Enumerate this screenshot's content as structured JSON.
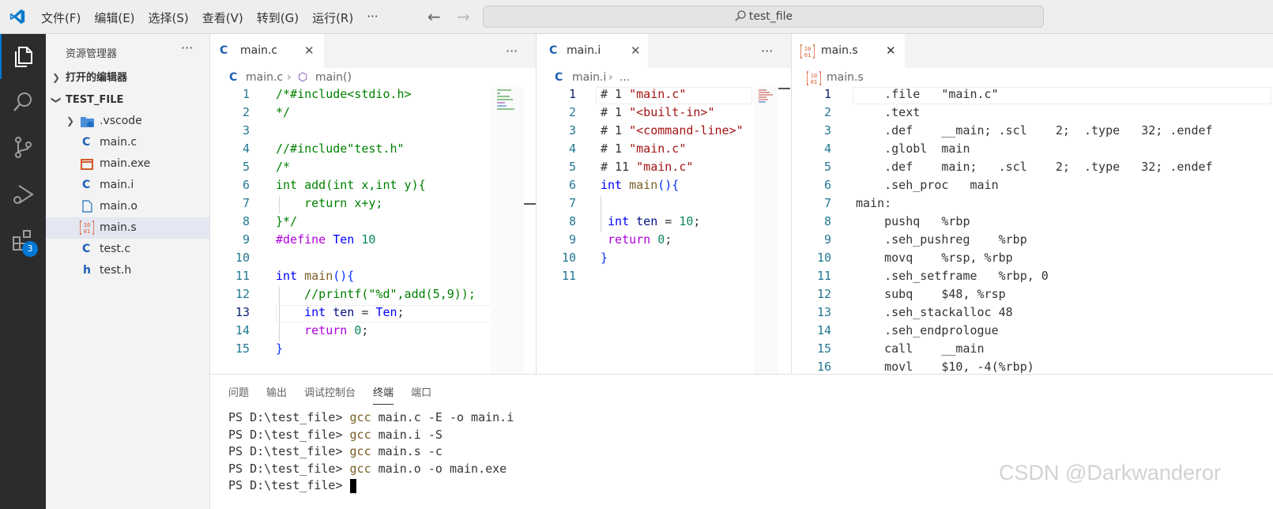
{
  "titlebar": {
    "menu": [
      "文件(F)",
      "编辑(E)",
      "选择(S)",
      "查看(V)",
      "转到(G)",
      "运行(R)",
      "···"
    ],
    "search_text": "test_file"
  },
  "activity_bar": {
    "icons": [
      "explorer-icon",
      "search-icon",
      "source-control-icon",
      "run-debug-icon",
      "extensions-icon"
    ],
    "extensions_badge": "3"
  },
  "sidebar": {
    "title": "资源管理器",
    "more": "···",
    "open_editors": "打开的编辑器",
    "folder": "TEST_FILE",
    "items": [
      {
        "label": ".vscode",
        "icon": "C"
      },
      {
        "label": "main.c",
        "icon": "C"
      },
      {
        "label": "main.exe",
        "icon": "▭"
      },
      {
        "label": "main.i",
        "icon": "C"
      },
      {
        "label": "main.o",
        "icon": "▯"
      },
      {
        "label": "main.s",
        "icon": "10 01"
      },
      {
        "label": "test.c",
        "icon": "C"
      },
      {
        "label": "test.h",
        "icon": "h"
      }
    ]
  },
  "editors": {
    "left": {
      "tab": "main.c",
      "tab_icon": "C",
      "more": "···",
      "crumb_file": "main.c",
      "crumb_sym": "main()",
      "lines": [
        "1",
        "2",
        "3",
        "4",
        "5",
        "6",
        "7",
        "8",
        "9",
        "10",
        "11",
        "12",
        "13",
        "14",
        "15"
      ]
    },
    "mid": {
      "tab": "main.i",
      "tab_icon": "C",
      "more": "···",
      "crumb_file": "main.i",
      "crumb_more": "...",
      "lines": [
        "1",
        "2",
        "3",
        "4",
        "5",
        "6",
        "7",
        "8",
        "9",
        "10",
        "11"
      ]
    },
    "right": {
      "tab": "main.s",
      "tab_icon": "10 01",
      "crumb_file": "main.s",
      "lines": [
        "1",
        "2",
        "3",
        "4",
        "5",
        "6",
        "7",
        "8",
        "9",
        "10",
        "11",
        "12",
        "13",
        "14",
        "15",
        "16"
      ],
      "code": [
        "    .file   \"main.c\"",
        "    .text",
        "    .def    __main; .scl    2;  .type   32; .endef",
        "    .globl  main",
        "    .def    main;   .scl    2;  .type   32; .endef",
        "    .seh_proc   main",
        "main:",
        "    pushq   %rbp",
        "    .seh_pushreg    %rbp",
        "    movq    %rsp, %rbp",
        "    .seh_setframe   %rbp, 0",
        "    subq    $48, %rsp",
        "    .seh_stackalloc 48",
        "    .seh_endprologue",
        "    call    __main",
        "    movl    $10, -4(%rbp)"
      ]
    }
  },
  "panel": {
    "tabs": [
      "问题",
      "输出",
      "调试控制台",
      "终端",
      "端口"
    ],
    "active_tab": "终端",
    "prompt": "PS D:\\test_file> ",
    "commands": [
      {
        "cmd": "gcc",
        "args": " main.c -E -o main.i"
      },
      {
        "cmd": "gcc",
        "args": " main.i -S"
      },
      {
        "cmd": "gcc",
        "args": " main.s -c"
      },
      {
        "cmd": "gcc",
        "args": " main.o -o main.exe"
      }
    ]
  },
  "watermark": "CSDN @Darkwanderor"
}
